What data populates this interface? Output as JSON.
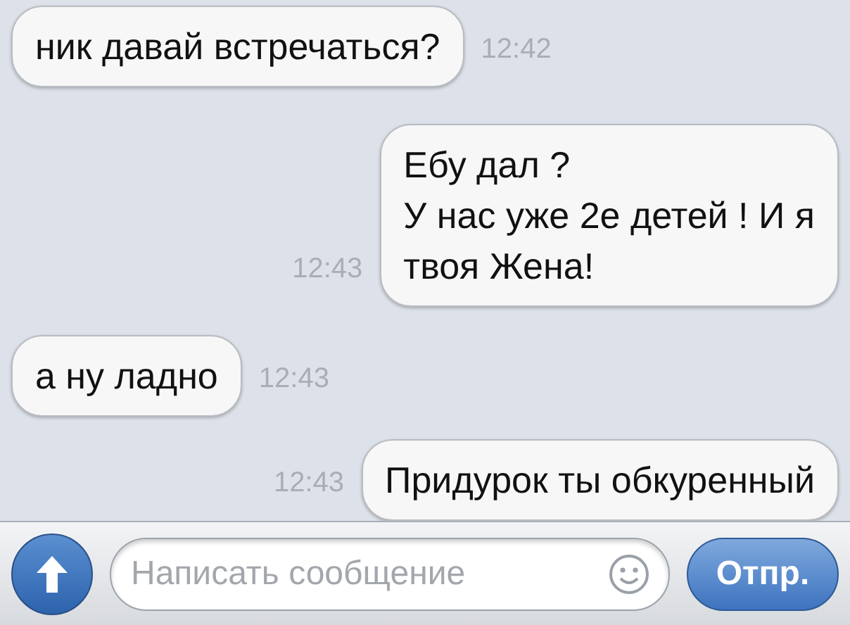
{
  "messages": [
    {
      "kind": "incoming",
      "lines": [
        "ник давай встречаться?"
      ],
      "time": "12:42"
    },
    {
      "kind": "outgoing",
      "lines": [
        "Ебу дал ?",
        "У нас уже 2е детей ! И я",
        "твоя Жена!"
      ],
      "time": "12:43"
    },
    {
      "kind": "incoming",
      "lines": [
        "а ну ладно"
      ],
      "time": "12:43"
    },
    {
      "kind": "outgoing",
      "lines": [
        "Придурок ты обкуренный"
      ],
      "time": "12:43"
    }
  ],
  "composer": {
    "placeholder": "Написать сообщение",
    "send": "Отпр."
  }
}
